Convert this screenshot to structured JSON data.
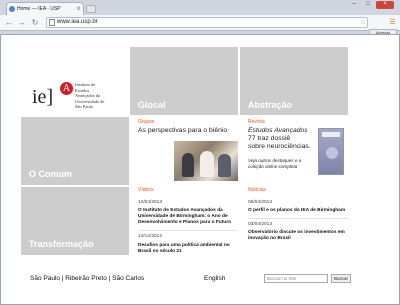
{
  "browser": {
    "tab_title": "Home — IEA - USP",
    "tab_close": "x",
    "url": "www.iea.usp.br",
    "acessar_label": "Acessar",
    "window_controls": [
      "–",
      "□",
      "×"
    ]
  },
  "logo": {
    "mark_text": "ie",
    "mark_bracket": "]",
    "letter": "A",
    "lines": [
      "Instituto de",
      "Estudos",
      "Avançados da",
      "Universidade de",
      "São Paulo"
    ]
  },
  "tiles": {
    "glocal": "Glocal",
    "abstracao": "Abstração",
    "comum": "O Comum",
    "transformacao": "Transformação"
  },
  "grupos": {
    "label": "Grupos",
    "title": "As perspectivas para o biênio"
  },
  "revista": {
    "label": "Revista",
    "title_italic": "Estudos Avançados",
    "title_rest_1": "77 traz dossiê",
    "title_rest_2": "sobre neurociências.",
    "note_line_1": "Veja outros destaques e a",
    "note_line_2": "coleção online completa"
  },
  "videos": {
    "label": "Vídeos",
    "items": [
      {
        "date": "12/04/2013",
        "title_lines": [
          "O Instituto de Estudos Avançados da",
          "Universidade de Birmingham: o Ano de",
          "Desenvolvimento e Planos para o Futuro"
        ]
      },
      {
        "date": "13/12/2012",
        "title_lines": [
          "Desafios para uma política ambiental no",
          "Brasil no século 21"
        ]
      }
    ]
  },
  "noticias": {
    "label": "Notícias",
    "items": [
      {
        "date": "06/04/2013",
        "title_lines": [
          "O perfil e os planos do IEA de Birmingham"
        ]
      },
      {
        "date": "03/04/2013",
        "title_lines": [
          "Observatório discute os investimentos em",
          "inovação no Brasil"
        ]
      }
    ]
  },
  "footer": {
    "campus_links": "São Paulo | Ribeirão Preto | São Carlos",
    "english": "English",
    "search_placeholder": "Buscar no Site",
    "search_button": "Buscar"
  },
  "icons": {
    "back": "back-arrow-icon",
    "forward": "forward-arrow-icon",
    "reload": "reload-icon",
    "page": "page-icon",
    "star": "star-icon",
    "wrench": "wrench-icon"
  },
  "colors": {
    "accent": "#e45b2a",
    "tile_gray": "#cdcdcd",
    "logo_red": "#c8232c"
  }
}
